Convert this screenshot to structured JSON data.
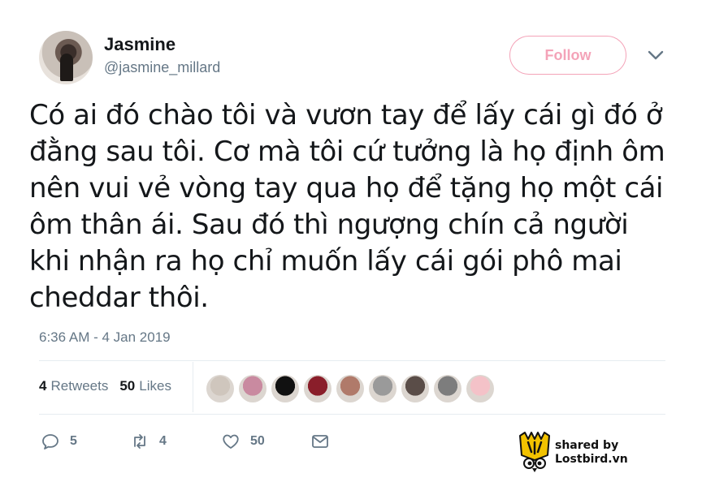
{
  "user": {
    "display_name": "Jasmine",
    "handle": "@jasmine_millard"
  },
  "follow_button": {
    "label": "Follow"
  },
  "tweet": {
    "lines": [
      "Có ai đó chào tôi và vươn tay để lấy cái gì đó ở",
      "đằng sau tôi. Cơ mà tôi cứ tưởng là họ định ôm",
      "nên vui vẻ vòng tay qua họ để tặng họ một cái",
      "ôm thân ái. Sau đó thì ngượng chín cả người",
      "khi nhận ra họ chỉ muốn lấy cái gói phô mai",
      "cheddar thôi."
    ],
    "timestamp": "6:36 AM - 4 Jan 2019"
  },
  "stats": {
    "retweets_count": "4",
    "retweets_label": "Retweets",
    "likes_count": "50",
    "likes_label": "Likes"
  },
  "liker_avatars": [
    "#cfc6bd",
    "#c98aa0",
    "#111111",
    "#8a1e2a",
    "#b07a6a",
    "#9a9a9a",
    "#5a4d48",
    "#7d7d7d",
    "#f4c2c8"
  ],
  "actions": {
    "reply_count": "5",
    "retweet_count": "4",
    "like_count": "50",
    "message_icon": "envelope-icon"
  },
  "watermark": {
    "line1": "shared by",
    "line2": "Lostbird.vn"
  },
  "colors": {
    "follow_accent": "#f4a3b8",
    "secondary_text": "#657786",
    "primary_text": "#14171a"
  }
}
